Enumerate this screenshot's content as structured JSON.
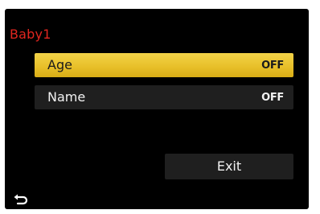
{
  "menu": {
    "title": "Baby1",
    "items": [
      {
        "label": "Age",
        "value": "OFF",
        "selected": true
      },
      {
        "label": "Name",
        "value": "OFF",
        "selected": false
      }
    ],
    "exit_label": "Exit",
    "back_icon": "return-arrow-icon"
  },
  "colors": {
    "background": "#000000",
    "title": "#e0261f",
    "highlight": "#e8c02a",
    "item_background": "#1f1f1f",
    "text": "#f2f2f2"
  }
}
